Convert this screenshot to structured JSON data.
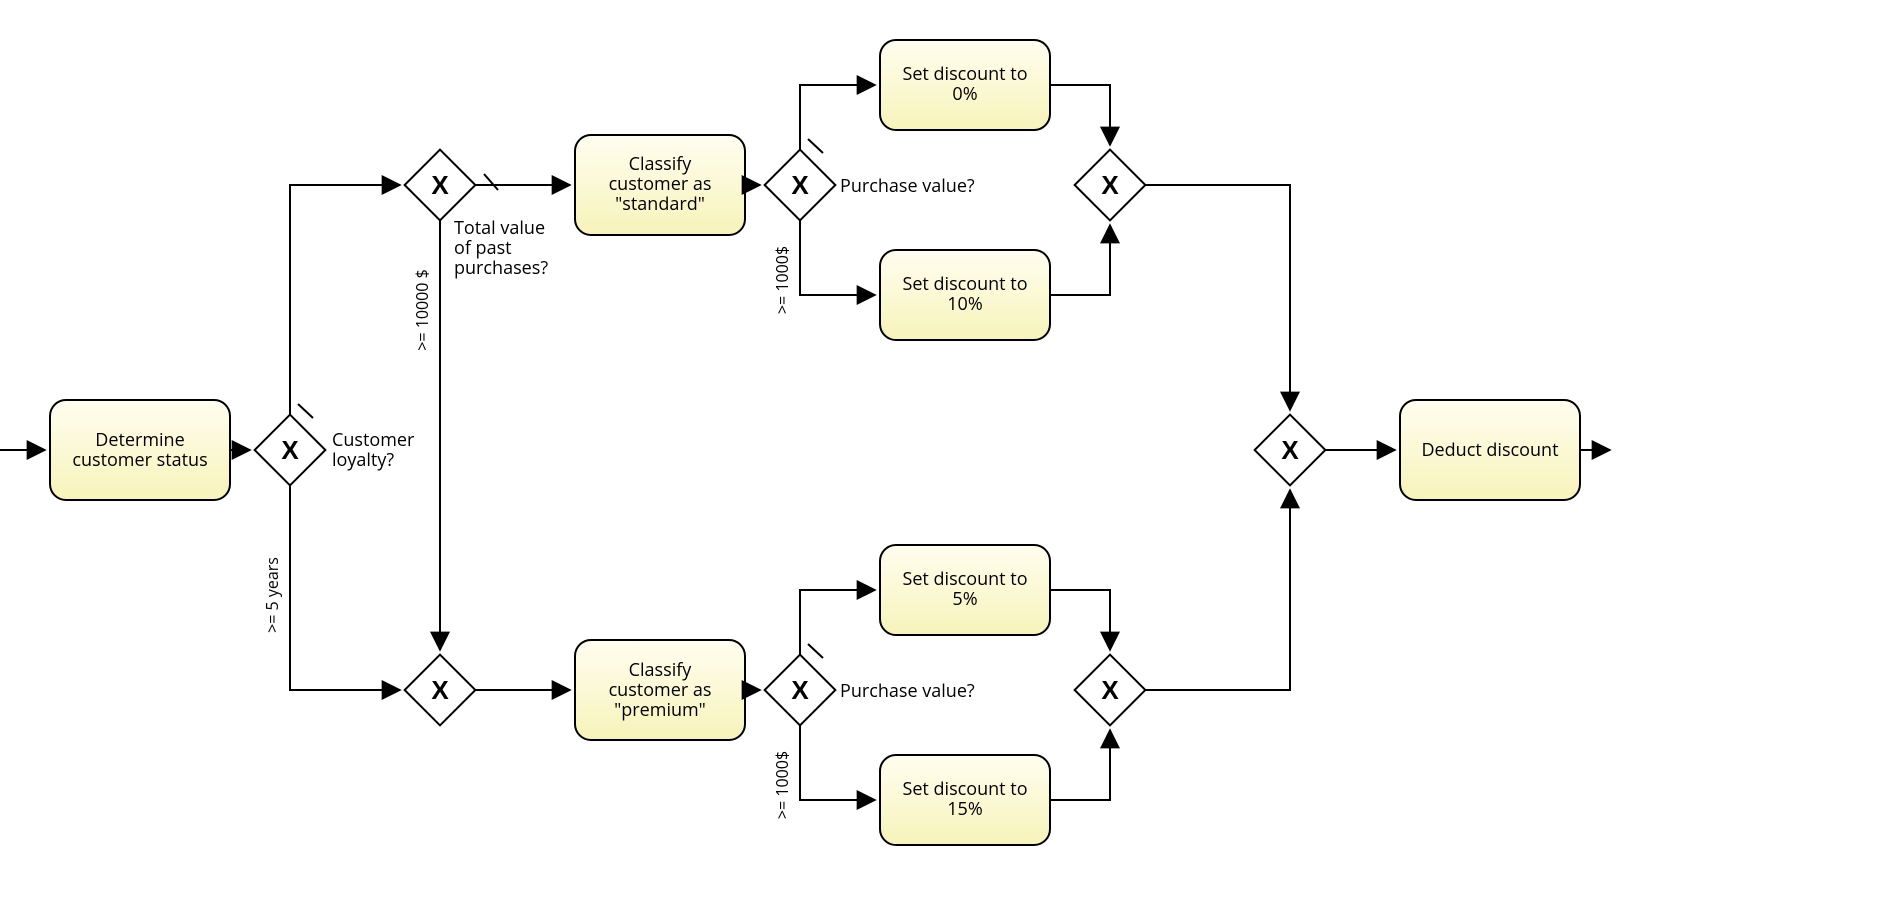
{
  "tasks": {
    "t1a": "Determine",
    "t1b": "customer status",
    "t2a": "Classify",
    "t2b": "customer as",
    "t2c": "\"standard\"",
    "t3a": "Classify",
    "t3b": "customer as",
    "t3c": "\"premium\"",
    "t4a": "Set discount to",
    "t4b": "0%",
    "t5a": "Set discount to",
    "t5b": "10%",
    "t6a": "Set discount to",
    "t6b": "5%",
    "t7a": "Set discount to",
    "t7b": "15%",
    "t8": "Deduct discount"
  },
  "gateways": {
    "g1a": "Customer",
    "g1b": "loyalty?",
    "g1cond": ">= 5 years",
    "g2a": "Total value",
    "g2b": "of past",
    "g2c": "purchases?",
    "g2cond": ">= 10000 $",
    "g3": "Purchase value?",
    "g3cond": ">= 1000$",
    "g4": "Purchase value?",
    "g4cond": ">= 1000$"
  }
}
